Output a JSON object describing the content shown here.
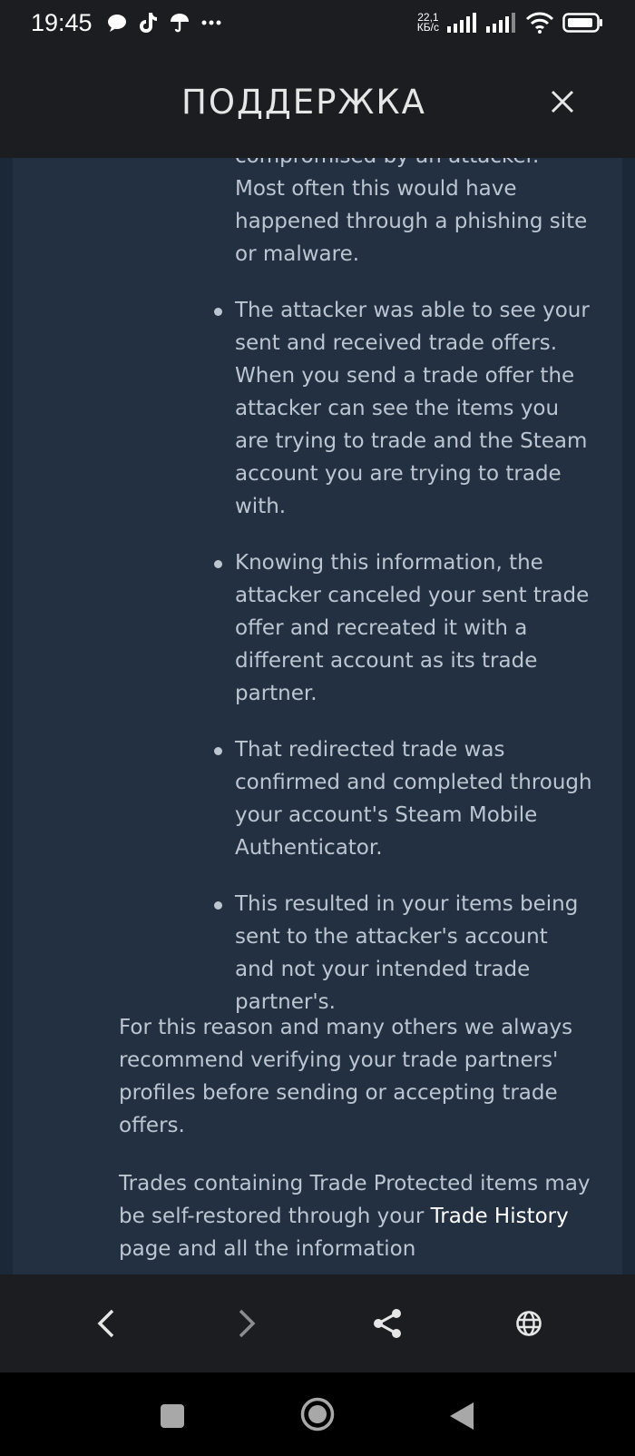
{
  "status_bar": {
    "time": "19:45",
    "net_speed_value": "22,1",
    "net_speed_unit": "КБ/с",
    "icons": [
      "chat-bubble-icon",
      "tiktok-icon",
      "umbrella-icon",
      "more-dots-icon",
      "signal-icon",
      "signal-icon",
      "wifi-icon",
      "battery-icon"
    ]
  },
  "header": {
    "title": "ПОДДЕРЖКА",
    "close_icon": "close-icon"
  },
  "content": {
    "bullet_first_partial": "compromised by an attacker. Most often this would have happened through a phishing site or malware.",
    "bullets": [
      "The attacker was able to see your sent and received trade offers. When you send a trade offer the attacker can see the items you are trying to trade and the Steam account you are trying to trade with.",
      "Knowing this information, the attacker canceled your sent trade offer and recreated it with a different account as its trade partner.",
      "That redirected trade was confirmed and completed through your account's Steam Mobile Authenticator.",
      "This resulted in your items being sent to the attacker's account and not your intended trade partner's."
    ],
    "para_recommend": "For this reason and many others we always recommend verifying your trade partners' profiles before sending or accepting trade offers.",
    "para_restore_before": "Trades containing Trade Protected items may be self-restored through your ",
    "para_restore_link": "Trade History",
    "para_restore_after": " page and all the information"
  },
  "browser_bar": {
    "icons": [
      "back-arrow-icon",
      "forward-arrow-icon",
      "share-icon",
      "globe-icon"
    ]
  },
  "nav_bar": {
    "icons": [
      "recents-square-icon",
      "home-circle-icon",
      "back-triangle-icon"
    ]
  }
}
